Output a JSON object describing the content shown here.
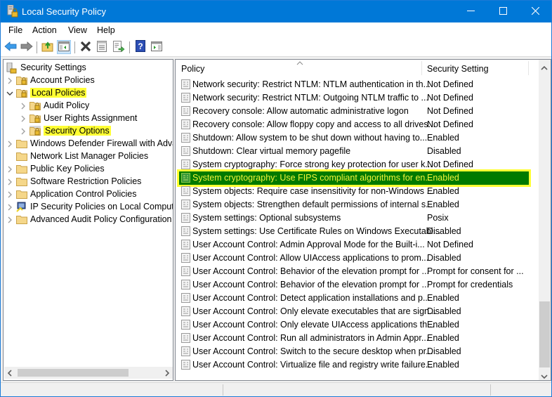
{
  "window": {
    "title": "Local Security Policy",
    "controls": {
      "minimize": "minimize",
      "maximize": "maximize",
      "close": "close"
    }
  },
  "menu": {
    "items": [
      "File",
      "Action",
      "View",
      "Help"
    ]
  },
  "toolbar": {
    "buttons": [
      {
        "name": "back",
        "icon": "arrow-left-icon"
      },
      {
        "name": "forward",
        "icon": "arrow-right-icon"
      },
      {
        "name": "up-one-level",
        "icon": "folder-up-icon"
      },
      {
        "name": "show-hide-console-tree",
        "icon": "console-tree-icon",
        "active": true
      },
      {
        "name": "delete",
        "icon": "delete-x-icon"
      },
      {
        "name": "properties",
        "icon": "properties-icon"
      },
      {
        "name": "export-list",
        "icon": "export-list-icon"
      },
      {
        "name": "help",
        "icon": "help-icon"
      },
      {
        "name": "show-hide-action-pane",
        "icon": "action-pane-icon"
      }
    ]
  },
  "tree": {
    "root": "Security Settings",
    "items": [
      {
        "label": "Account Policies",
        "level": 1,
        "expander": "collapsed",
        "highlighted": false
      },
      {
        "label": "Local Policies",
        "level": 1,
        "expander": "expanded",
        "highlighted": true
      },
      {
        "label": "Audit Policy",
        "level": 2,
        "expander": "collapsed",
        "highlighted": false
      },
      {
        "label": "User Rights Assignment",
        "level": 2,
        "expander": "collapsed",
        "highlighted": false
      },
      {
        "label": "Security Options",
        "level": 2,
        "expander": "collapsed",
        "highlighted": true,
        "selected": true
      },
      {
        "label": "Windows Defender Firewall with Advanced Security",
        "level": 1,
        "expander": "collapsed",
        "highlighted": false
      },
      {
        "label": "Network List Manager Policies",
        "level": 1,
        "expander": "none",
        "highlighted": false
      },
      {
        "label": "Public Key Policies",
        "level": 1,
        "expander": "collapsed",
        "highlighted": false
      },
      {
        "label": "Software Restriction Policies",
        "level": 1,
        "expander": "collapsed",
        "highlighted": false
      },
      {
        "label": "Application Control Policies",
        "level": 1,
        "expander": "collapsed",
        "highlighted": false
      },
      {
        "label": "IP Security Policies on Local Computer",
        "level": 1,
        "expander": "collapsed",
        "highlighted": false,
        "icon": "ip-security-icon"
      },
      {
        "label": "Advanced Audit Policy Configuration",
        "level": 1,
        "expander": "collapsed",
        "highlighted": false
      }
    ]
  },
  "list": {
    "columns": [
      "Policy",
      "Security Setting"
    ],
    "sorted_column": "Policy",
    "rows": [
      {
        "policy": "Network security: Restrict NTLM: NTLM authentication in th...",
        "setting": "Not Defined"
      },
      {
        "policy": "Network security: Restrict NTLM: Outgoing NTLM traffic to ...",
        "setting": "Not Defined"
      },
      {
        "policy": "Recovery console: Allow automatic administrative logon",
        "setting": "Not Defined"
      },
      {
        "policy": "Recovery console: Allow floppy copy and access to all drives...",
        "setting": "Not Defined"
      },
      {
        "policy": "Shutdown: Allow system to be shut down without having to...",
        "setting": "Enabled"
      },
      {
        "policy": "Shutdown: Clear virtual memory pagefile",
        "setting": "Disabled"
      },
      {
        "policy": "System cryptography: Force strong key protection for user k...",
        "setting": "Not Defined"
      },
      {
        "policy": "System cryptography: Use FIPS compliant algorithms for en...",
        "setting": "Enabled",
        "selected": true
      },
      {
        "policy": "System objects: Require case insensitivity for non-Windows ...",
        "setting": "Enabled"
      },
      {
        "policy": "System objects: Strengthen default permissions of internal s...",
        "setting": "Enabled"
      },
      {
        "policy": "System settings: Optional subsystems",
        "setting": "Posix"
      },
      {
        "policy": "System settings: Use Certificate Rules on Windows Executabl...",
        "setting": "Disabled"
      },
      {
        "policy": "User Account Control: Admin Approval Mode for the Built-i...",
        "setting": "Not Defined"
      },
      {
        "policy": "User Account Control: Allow UIAccess applications to prom...",
        "setting": "Disabled"
      },
      {
        "policy": "User Account Control: Behavior of the elevation prompt for ...",
        "setting": "Prompt for consent for ..."
      },
      {
        "policy": "User Account Control: Behavior of the elevation prompt for ...",
        "setting": "Prompt for credentials"
      },
      {
        "policy": "User Account Control: Detect application installations and p...",
        "setting": "Enabled"
      },
      {
        "policy": "User Account Control: Only elevate executables that are sign...",
        "setting": "Disabled"
      },
      {
        "policy": "User Account Control: Only elevate UIAccess applications th...",
        "setting": "Enabled"
      },
      {
        "policy": "User Account Control: Run all administrators in Admin Appr...",
        "setting": "Enabled"
      },
      {
        "policy": "User Account Control: Switch to the secure desktop when pr...",
        "setting": "Disabled"
      },
      {
        "policy": "User Account Control: Virtualize file and registry write failure...",
        "setting": "Enabled"
      }
    ],
    "vertical_scroll_position": 0.95
  },
  "colors": {
    "titlebar": "#0078d7",
    "highlight_yellow": "#ffff33",
    "selected_row_bg": "#007a00",
    "selected_row_text": "#f2f23a"
  }
}
